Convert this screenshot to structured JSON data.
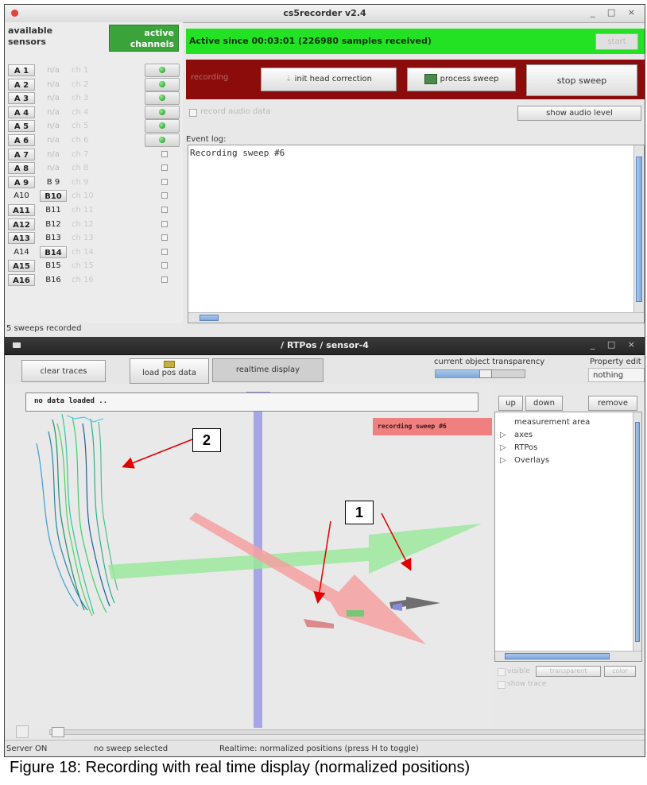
{
  "main_window": {
    "title": "cs5recorder v2.4",
    "window_controls": "_ □ ×",
    "sensors_header": {
      "available": "available sensors",
      "active": "active channels"
    },
    "sensors": [
      {
        "a": "A 1",
        "b": "n/a",
        "ch": "ch 1",
        "active": true
      },
      {
        "a": "A 2",
        "b": "n/a",
        "ch": "ch 2",
        "active": true
      },
      {
        "a": "A 3",
        "b": "n/a",
        "ch": "ch 3",
        "active": true
      },
      {
        "a": "A 4",
        "b": "n/a",
        "ch": "ch 4",
        "active": true
      },
      {
        "a": "A 5",
        "b": "n/a",
        "ch": "ch 5",
        "active": true
      },
      {
        "a": "A 6",
        "b": "n/a",
        "ch": "ch 6",
        "active": true
      },
      {
        "a": "A 7",
        "b": "n/a",
        "ch": "ch 7",
        "active": false
      },
      {
        "a": "A 8",
        "b": "n/a",
        "ch": "ch 8",
        "active": false
      },
      {
        "a": "A 9",
        "b": "B 9",
        "ch": "ch 9",
        "active": false
      },
      {
        "a": "A10",
        "b": "B10",
        "ch": "ch 10",
        "active": false,
        "b_selected": true
      },
      {
        "a": "A11",
        "b": "B11",
        "ch": "ch 11",
        "active": false
      },
      {
        "a": "A12",
        "b": "B12",
        "ch": "ch 12",
        "active": false
      },
      {
        "a": "A13",
        "b": "B13",
        "ch": "ch 13",
        "active": false
      },
      {
        "a": "A14",
        "b": "B14",
        "ch": "ch 14",
        "active": false,
        "b_selected": true
      },
      {
        "a": "A15",
        "b": "B15",
        "ch": "ch 15",
        "active": false
      },
      {
        "a": "A16",
        "b": "B16",
        "ch": "ch 16",
        "active": false
      }
    ],
    "status_text": "Active since 00:03:01 (226980 samples received)",
    "start_label": "start",
    "recording_label": "recording",
    "init_head_label": "init head correction",
    "process_sweep_label": "process sweep",
    "stop_sweep_label": "stop sweep",
    "record_audio_label": "record audio data",
    "show_audio_label": "show audio level",
    "event_log_label": "Event log:",
    "event_log_text": "Recording sweep #6",
    "sweeps_recorded": "5 sweeps recorded"
  },
  "rtpos_window": {
    "title": "/ RTPos / sensor-4",
    "window_controls": "_ □ ×",
    "clear_traces_label": "clear traces",
    "load_pos_label": "load pos data",
    "realtime_label": "realtime display",
    "transparency_label": "current object transparency",
    "transparency_value": 0.55,
    "property_label": "Property edit",
    "property_value": "nothing",
    "no_data_text": "no data loaded ..",
    "recording_overlay": "recording sweep #6",
    "up_label": "up",
    "down_label": "down",
    "remove_label": "remove",
    "tree_items": [
      {
        "arrow": "",
        "label": "measurement area"
      },
      {
        "arrow": "▷",
        "label": "axes"
      },
      {
        "arrow": "▷",
        "label": "RTPos"
      },
      {
        "arrow": "▷",
        "label": "Overlays"
      }
    ],
    "visible_label": "visible",
    "transparent_label": "transparent",
    "color_label": "color",
    "show_trace_label": "show trace",
    "status_server": "Server ON",
    "status_sweep": "no sweep selected",
    "status_realtime": "Realtime: normalized positions (press H to toggle)"
  },
  "annotations": {
    "label_1": "1",
    "label_2": "2"
  },
  "caption": "Figure 18:  Recording with real time display (normalized positions)",
  "colors": {
    "green_status": "#23e223",
    "record_red": "#8c0c0c",
    "active_green": "#3aa33a"
  }
}
